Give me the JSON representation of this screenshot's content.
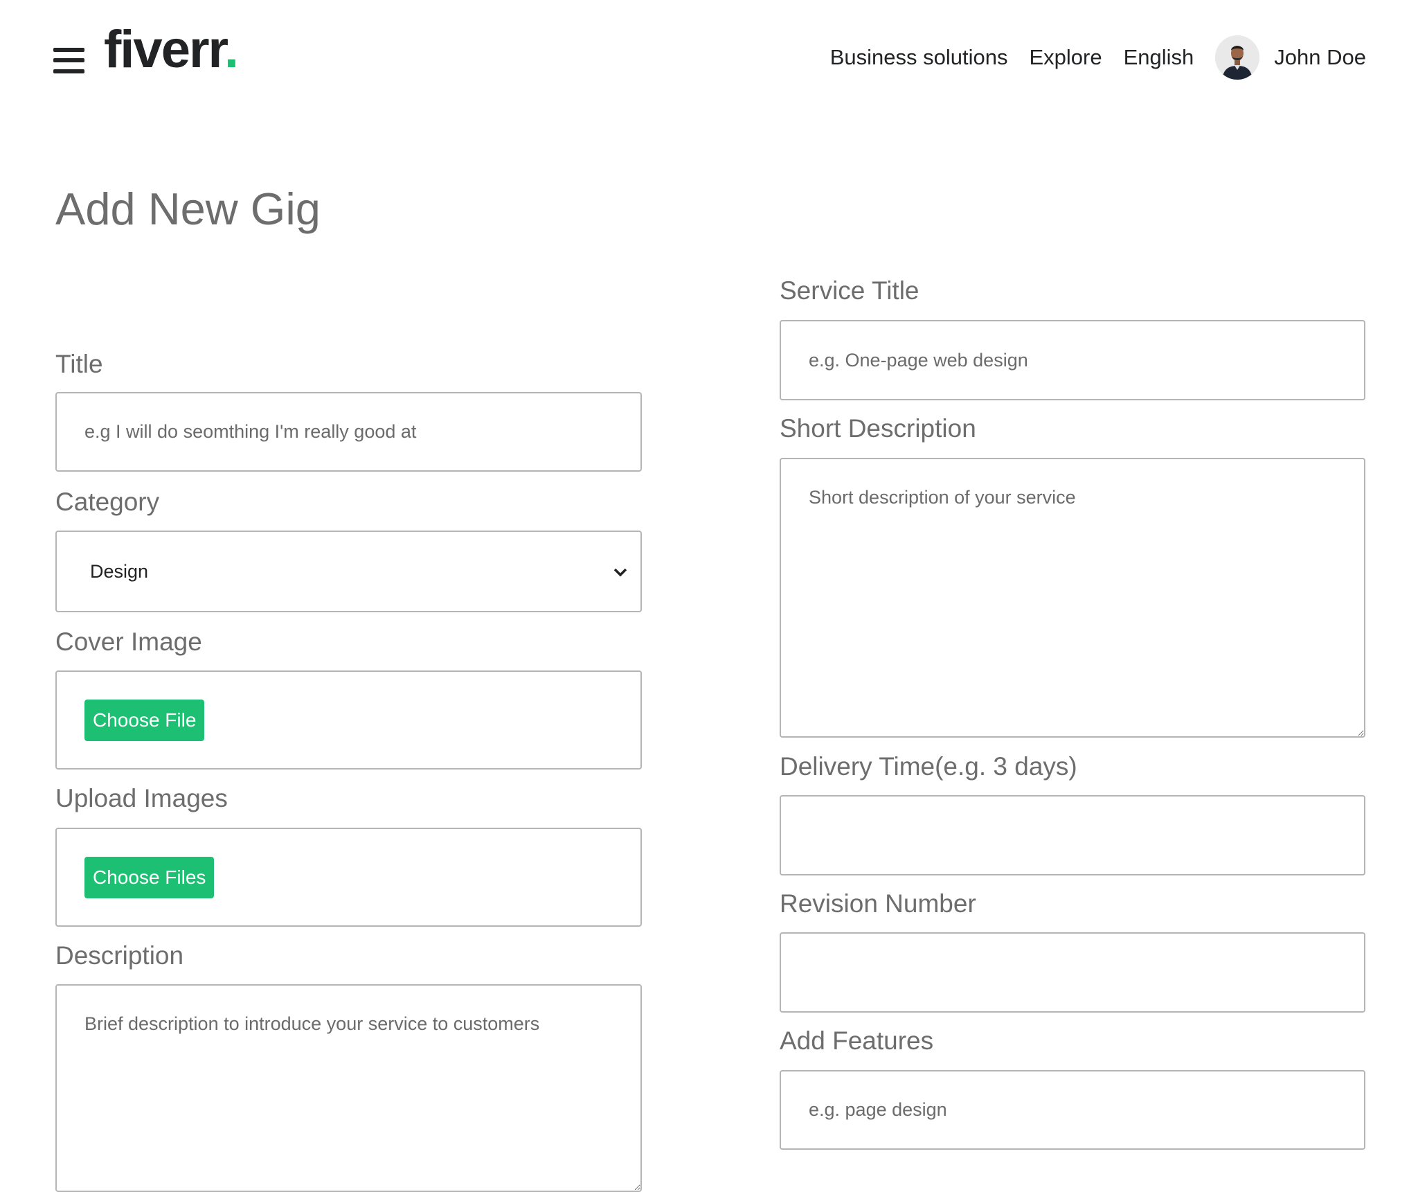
{
  "header": {
    "logo_text": "fiverr",
    "logo_dot": ".",
    "brand_color": "#1dbf73",
    "nav_links": [
      "Business solutions",
      "Explore",
      "English"
    ],
    "user_name": "John Doe"
  },
  "page": {
    "title": "Add New Gig"
  },
  "left_form": {
    "title_label": "Title",
    "title_placeholder": "e.g I will do seomthing I'm really good at",
    "category_label": "Category",
    "category_selected": "Design",
    "cover_image_label": "Cover Image",
    "cover_image_button": "Choose File",
    "upload_images_label": "Upload Images",
    "upload_images_button": "Choose Files",
    "description_label": "Description",
    "description_placeholder": "Brief description to introduce your service to customers"
  },
  "right_form": {
    "service_title_label": "Service Title",
    "service_title_placeholder": "e.g. One-page web design",
    "short_description_label": "Short Description",
    "short_description_placeholder": "Short description of your service",
    "delivery_time_label": "Delivery Time(e.g. 3 days)",
    "delivery_time_value": "",
    "revision_number_label": "Revision Number",
    "revision_number_value": "",
    "add_features_label": "Add Features",
    "add_features_placeholder": "e.g. page design"
  }
}
